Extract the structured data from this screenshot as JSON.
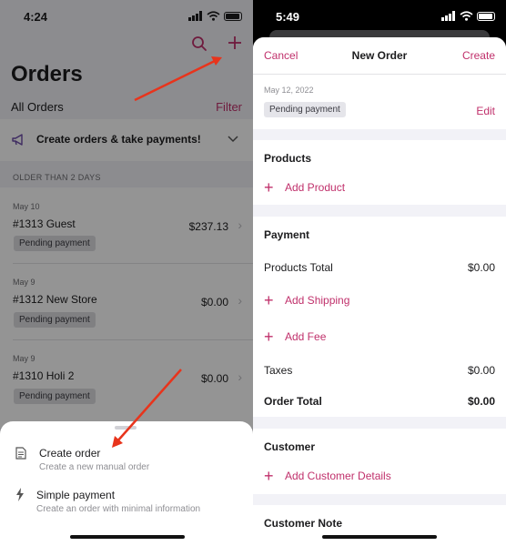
{
  "left": {
    "status_time": "4:24",
    "title": "Orders",
    "all_orders": "All Orders",
    "filter": "Filter",
    "promo": "Create orders & take payments!",
    "section_header": "OLDER THAN 2 DAYS",
    "orders": [
      {
        "date": "May 10",
        "name": "#1313 Guest",
        "amount": "$237.13",
        "status": "Pending payment"
      },
      {
        "date": "May 9",
        "name": "#1312 New Store",
        "amount": "$0.00",
        "status": "Pending payment"
      },
      {
        "date": "May 9",
        "name": "#1310 Holi 2",
        "amount": "$0.00",
        "status": "Pending payment"
      }
    ],
    "sheet": {
      "create_order": {
        "title": "Create order",
        "subtitle": "Create a new manual order"
      },
      "simple_payment": {
        "title": "Simple payment",
        "subtitle": "Create an order with minimal information"
      }
    }
  },
  "right": {
    "status_time": "5:49",
    "nav": {
      "cancel": "Cancel",
      "title": "New Order",
      "create": "Create"
    },
    "date": "May 12, 2022",
    "status_badge": "Pending payment",
    "edit": "Edit",
    "products": {
      "title": "Products",
      "add_product": "Add Product"
    },
    "payment": {
      "title": "Payment",
      "products_total_label": "Products Total",
      "products_total_value": "$0.00",
      "add_shipping": "Add Shipping",
      "add_fee": "Add Fee",
      "taxes_label": "Taxes",
      "taxes_value": "$0.00",
      "order_total_label": "Order Total",
      "order_total_value": "$0.00"
    },
    "customer": {
      "title": "Customer",
      "add_details": "Add Customer Details"
    },
    "customer_note": {
      "title": "Customer Note"
    }
  },
  "colors": {
    "accent": "#c0306b",
    "arrow": "#e8341c"
  }
}
